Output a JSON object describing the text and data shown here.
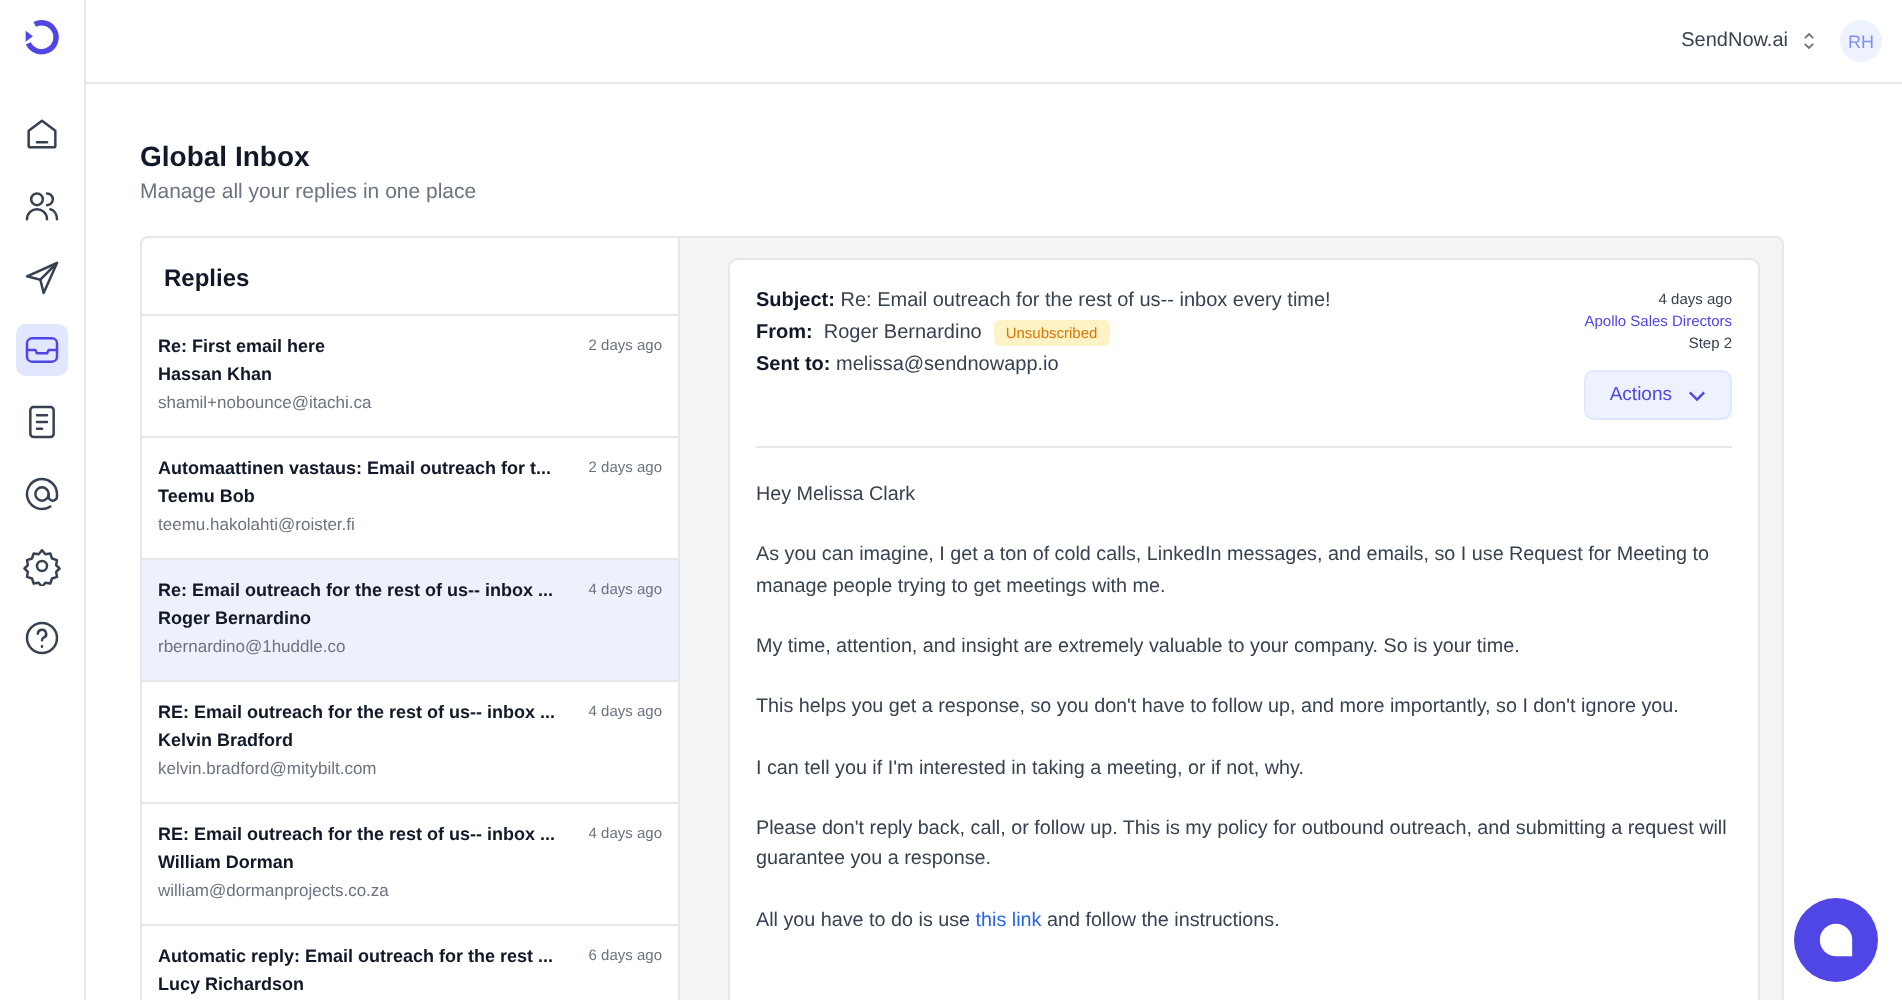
{
  "header": {
    "workspace": "SendNow.ai",
    "avatar": "RH"
  },
  "nav": [
    {
      "selected": false
    },
    {
      "selected": false
    },
    {
      "selected": false
    },
    {
      "selected": true
    },
    {
      "selected": false
    },
    {
      "selected": false
    },
    {
      "selected": false
    },
    {
      "selected": false
    }
  ],
  "page": {
    "title": "Global Inbox",
    "subtitle": "Manage all your replies in one place"
  },
  "replies": {
    "title": "Replies",
    "items": [
      {
        "subject": "Re: First email here",
        "time": "2 days ago",
        "name": "Hassan Khan",
        "email": "shamil+nobounce@itachi.ca",
        "selected": false
      },
      {
        "subject": "Automaattinen vastaus: Email outreach for t...",
        "time": "2 days ago",
        "name": "Teemu Bob",
        "email": "teemu.hakolahti@roister.fi",
        "selected": false
      },
      {
        "subject": "Re: Email outreach for the rest of us-- inbox ...",
        "time": "4 days ago",
        "name": "Roger Bernardino",
        "email": "rbernardino@1huddle.co",
        "selected": true
      },
      {
        "subject": "RE: Email outreach for the rest of us-- inbox ...",
        "time": "4 days ago",
        "name": "Kelvin Bradford",
        "email": "kelvin.bradford@mitybilt.com",
        "selected": false
      },
      {
        "subject": "RE: Email outreach for the rest of us-- inbox ...",
        "time": "4 days ago",
        "name": "William Dorman",
        "email": "william@dormanprojects.co.za",
        "selected": false
      },
      {
        "subject": "Automatic reply: Email outreach for the rest ...",
        "time": "6 days ago",
        "name": "Lucy Richardson",
        "selected": false
      }
    ]
  },
  "message": {
    "subject_label": "Subject:",
    "subject": "Re: Email outreach for the rest of us-- inbox every time!",
    "from_label": "From:",
    "from": "Roger Bernardino",
    "badge": "Unsubscribed",
    "to_label": "Sent to:",
    "to": "melissa@sendnowapp.io",
    "time": "4 days ago",
    "campaign": "Apollo Sales Directors",
    "step": "Step 2",
    "actions": "Actions",
    "body": [
      {
        "text": "Hey Melissa Clark"
      },
      {
        "text": "As you can imagine, I get a ton of cold calls, LinkedIn messages, and emails, so I use Request for Meeting to manage people trying to get meetings with me."
      },
      {
        "text": "My time, attention, and insight are extremely valuable to your company. So is your time."
      },
      {
        "text": "This helps you get a response, so you don't have to follow up, and more importantly, so I don't ignore you."
      },
      {
        "text": "I can tell you if I'm interested in taking a meeting, or if not, why."
      },
      {
        "text": "Please don't reply back, call, or follow up. This is my policy for outbound outreach, and submitting a request will guarantee you a response."
      },
      {
        "text": "All you have to do is use ",
        "link": "this link",
        "after": " and follow the instructions."
      }
    ]
  }
}
